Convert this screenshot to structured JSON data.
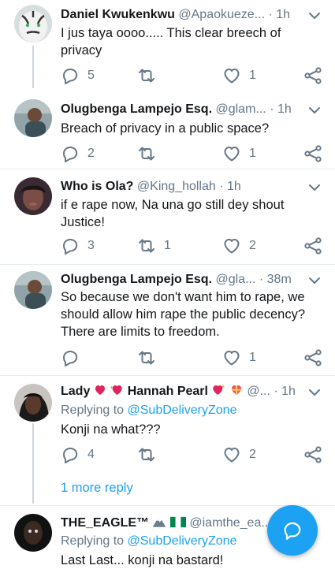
{
  "colors": {
    "accent": "#1da1f2",
    "muted": "#657786",
    "text": "#14171a"
  },
  "tweets": [
    {
      "name": "Daniel Kwukenkwu",
      "handle": "@Apaokueze...",
      "dot": "·",
      "time": "1h",
      "text": "I jus taya oooo..... This clear breech of privacy",
      "replies": "5",
      "retweets": "",
      "likes": "1",
      "avatar_icon": "tiger-avatar"
    },
    {
      "name": "Olugbenga Lampejo Esq.",
      "handle": "@glam...",
      "dot": "·",
      "time": "1h",
      "text": "Breach of privacy in a public space?",
      "replies": "2",
      "retweets": "",
      "likes": "1",
      "avatar_icon": "person-avatar"
    },
    {
      "name": "Who is Ola?",
      "handle": "@King_hollah",
      "dot": "·",
      "time": "1h",
      "text": "if e rape now, Na una go still dey shout Justice!",
      "replies": "3",
      "retweets": "1",
      "likes": "2",
      "avatar_icon": "woman-avatar"
    },
    {
      "name": "Olugbenga Lampejo Esq.",
      "handle": "@gla...",
      "dot": "·",
      "time": "38m",
      "text": "So because we don't want him to rape, we should allow him rape the public decency? There are limits to freedom.",
      "replies": "",
      "retweets": "",
      "likes": "1",
      "avatar_icon": "person-avatar"
    },
    {
      "name_a": "Lady",
      "name_b": "Hannah Pearl",
      "handle": "@...",
      "dot": "·",
      "time": "1h",
      "replying_prefix": "Replying to",
      "replying_to": "@SubDeliveryZone",
      "text": "Konji na what???",
      "replies": "4",
      "retweets": "",
      "likes": "2",
      "avatar_icon": "lady-avatar"
    },
    {
      "name": "THE_EAGLE™",
      "handle": "@iamthe_ea...",
      "replying_prefix": "Replying to",
      "replying_to": "@SubDeliveryZone",
      "text": "Last Last... konji na bastard!",
      "avatar_icon": "eagle-avatar"
    }
  ],
  "more_reply": "1 more reply",
  "fab_icon": "compose-reply-icon"
}
